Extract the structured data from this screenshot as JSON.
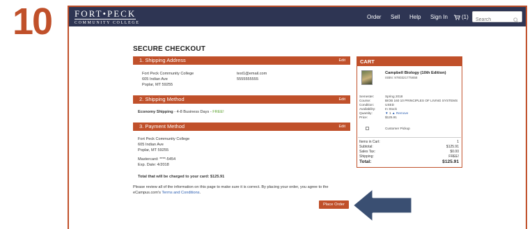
{
  "step_number": "10",
  "brand": {
    "name": "FORT•PECK",
    "subtitle": "COMMUNITY COLLEGE"
  },
  "nav": {
    "order": "Order",
    "sell": "Sell",
    "help": "Help",
    "sign_in": "Sign In",
    "cart_count": "(1)"
  },
  "search": {
    "placeholder": "Search"
  },
  "page_title": "SECURE CHECKOUT",
  "shipping_address": {
    "header": "1. Shipping Address",
    "edit": "Edit",
    "name": "Fort Peck Community College",
    "street": "605 Indian Ave",
    "city": "Poplar, MT 59255",
    "email": "test1@email.com",
    "phone": "5555555555"
  },
  "shipping_method": {
    "header": "2. Shipping Method",
    "edit": "Edit",
    "method": "Economy Shipping",
    "detail": " - 4-8 Business Days - ",
    "price": "FREE!"
  },
  "payment_method": {
    "header": "3. Payment Method",
    "edit": "Edit",
    "name": "Fort Peck Community College",
    "street": "605 Indian Ave",
    "city": "Poplar, MT 59255",
    "card": "Mastercard: ****-5454",
    "exp": "Exp. Date: 4/2018",
    "total_note": "Total that will be charged to your card: $125.91"
  },
  "review": {
    "line1": "Please review all of the information on this page to make sure it is correct. By placing your order, you agree to the",
    "line2_prefix": "eCampus.com's ",
    "terms_link": "Terms and Conditions",
    "line2_suffix": "."
  },
  "place_order": "Place Order",
  "cart": {
    "header": "CART",
    "book_title": "Campbell Biology (10th Edition)",
    "isbn": "ISBN: 9780321775658",
    "fields": [
      {
        "label": "Semester:",
        "value": "Spring 2018"
      },
      {
        "label": "Course:",
        "value": "BIOB 160 10 PRINCIPLES OF LIVING SYSTEMS"
      },
      {
        "label": "Condition:",
        "value": "USED"
      },
      {
        "label": "Availability:",
        "value": "In Stock"
      }
    ],
    "quantity_label": "Quantity:",
    "quantity": "1",
    "remove": "Remove",
    "price_label": "Price:",
    "price": "$125.91",
    "pickup": "Customer Pickup",
    "summary": [
      {
        "label": "Items in Cart:",
        "value": "1"
      },
      {
        "label": "Subtotal:",
        "value": "$125.91"
      },
      {
        "label": "Sales Tax:",
        "value": "$0.00"
      },
      {
        "label": "Shipping:",
        "value": "FREE!"
      }
    ],
    "total_label": "Total:",
    "total": "$125.91"
  },
  "colors": {
    "accent": "#c0502a",
    "navbar": "#2e3553",
    "arrow": "#3a4f72",
    "free": "#5aa02c",
    "link": "#2a5db0"
  }
}
